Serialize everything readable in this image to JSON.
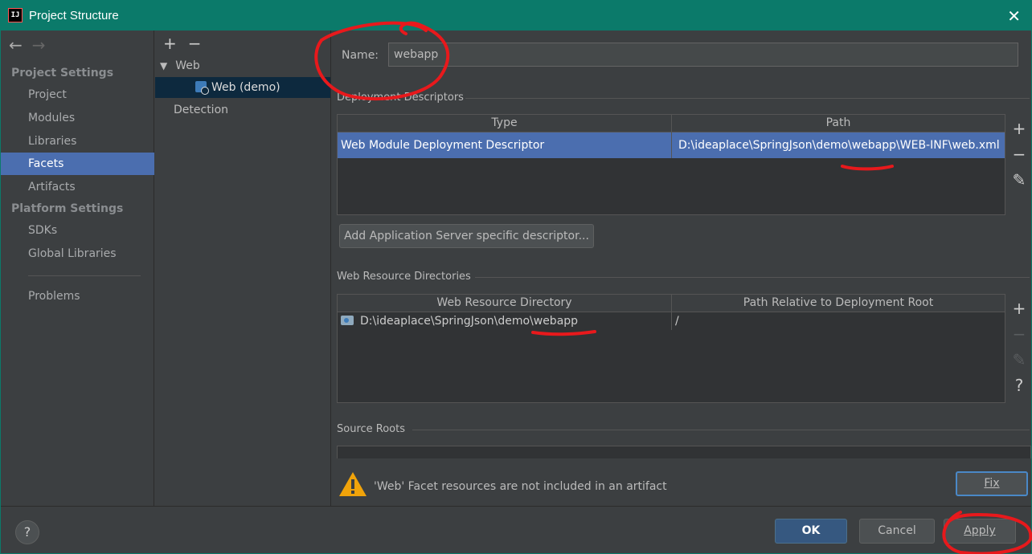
{
  "window": {
    "title": "Project Structure",
    "close_glyph": "✕",
    "app_icon": "IJ"
  },
  "nav": {
    "back": "←",
    "forward": "→"
  },
  "sidebar": {
    "project_settings_header": "Project Settings",
    "items_project": [
      {
        "label": "Project"
      },
      {
        "label": "Modules"
      },
      {
        "label": "Libraries"
      },
      {
        "label": "Facets",
        "selected": true
      },
      {
        "label": "Artifacts"
      }
    ],
    "platform_settings_header": "Platform Settings",
    "items_platform": [
      {
        "label": "SDKs"
      },
      {
        "label": "Global Libraries"
      }
    ],
    "problems": "Problems"
  },
  "facet_tree": {
    "add": "+",
    "remove": "−",
    "root": "Web",
    "child": "Web (demo)",
    "detection": "Detection"
  },
  "facet": {
    "name_label": "Name:",
    "name_value": "webapp",
    "deployment_descriptors": {
      "title": "Deployment Descriptors",
      "columns": [
        "Type",
        "Path"
      ],
      "rows": [
        {
          "type": "Web Module Deployment Descriptor",
          "path": "D:\\ideaplace\\SpringJson\\demo\\webapp\\WEB-INF\\web.xml"
        }
      ],
      "add_server_button": "Add Application Server specific descriptor..."
    },
    "web_resource_dirs": {
      "title": "Web Resource Directories",
      "columns": [
        "Web Resource Directory",
        "Path Relative to Deployment Root"
      ],
      "rows": [
        {
          "dir": "D:\\ideaplace\\SpringJson\\demo\\webapp",
          "rel": "/"
        }
      ]
    },
    "source_roots": {
      "title": "Source Roots"
    },
    "warning": {
      "text": "'Web' Facet resources are not included in an artifact",
      "fix_label": "Fix"
    }
  },
  "side_tools": {
    "add": "+",
    "remove": "−",
    "edit": "✎",
    "help": "?"
  },
  "footer": {
    "help": "?",
    "ok": "OK",
    "cancel": "Cancel",
    "apply": "Apply"
  },
  "colors": {
    "titlebar": "#0b7a6a",
    "selection": "#4b6eaf",
    "annotation": "#e8191c"
  }
}
